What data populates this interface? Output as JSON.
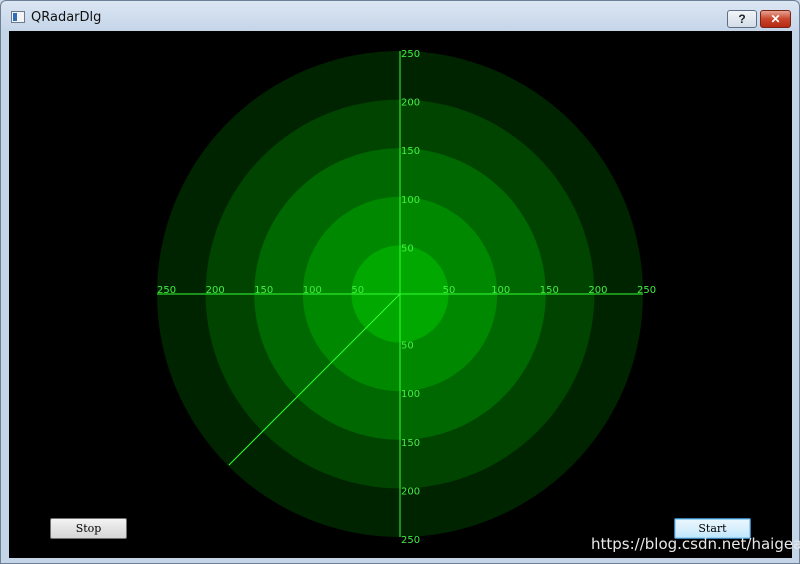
{
  "window": {
    "title": "QRadarDlg",
    "help_label": "?",
    "close_label": "✕"
  },
  "radar": {
    "max_range": 250,
    "ring_step": 50,
    "sweep_angle_deg": 225,
    "axis_labels": {
      "left": [
        "250",
        "200",
        "150",
        "100",
        "50"
      ],
      "right": [
        "50",
        "100",
        "150",
        "200",
        "250"
      ],
      "top": [
        "250",
        "200",
        "150",
        "100",
        "50"
      ],
      "bottom": [
        "50",
        "100",
        "150",
        "200",
        "250"
      ]
    },
    "colors": {
      "background": "#000000",
      "ring_1": "#00a800",
      "ring_2": "#008800",
      "ring_3": "#006800",
      "ring_4": "#004400",
      "ring_5": "#002400",
      "line": "#33ff33",
      "label": "#44ee44"
    }
  },
  "buttons": {
    "stop_label": "Stop",
    "start_label": "Start"
  },
  "watermark": "https://blog.csdn.net/haigear"
}
